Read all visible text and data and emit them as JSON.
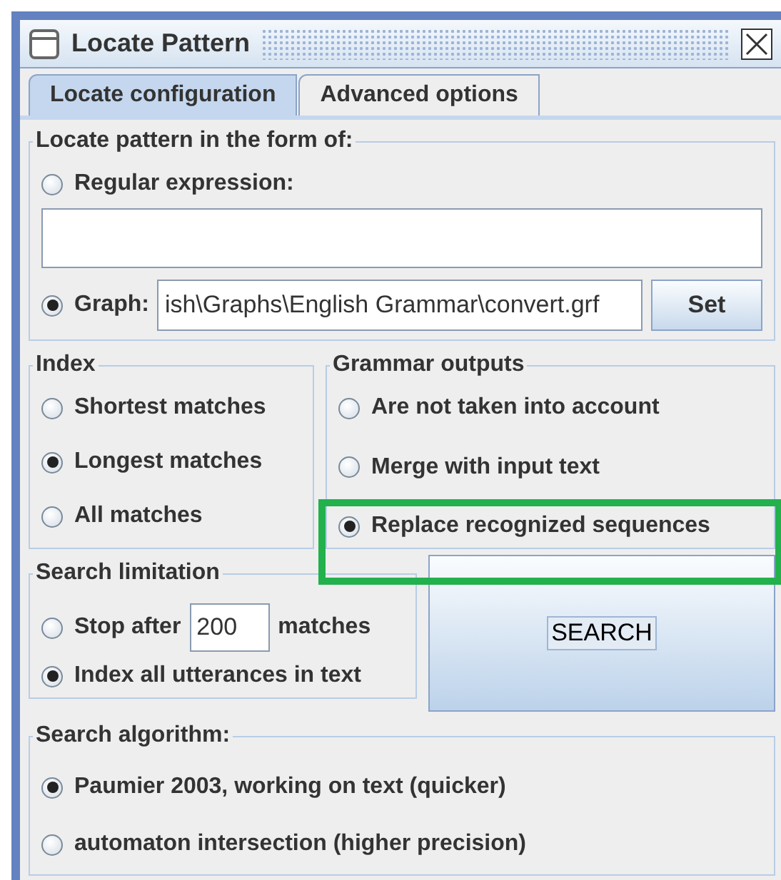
{
  "window": {
    "title": "Locate Pattern"
  },
  "tabs": [
    {
      "label": "Locate configuration",
      "selected": true
    },
    {
      "label": "Advanced options",
      "selected": false
    }
  ],
  "pattern_group": {
    "title": "Locate pattern in the form of:",
    "regex_option": {
      "label": "Regular expression:",
      "selected": false
    },
    "graph_option": {
      "label": "Graph:",
      "selected": true
    },
    "graph_field": {
      "value": "ish\\Graphs\\English Grammar\\convert.grf"
    },
    "set_button": "Set"
  },
  "index_group": {
    "title": "Index",
    "options": [
      {
        "label": "Shortest matches",
        "selected": false
      },
      {
        "label": "Longest matches",
        "selected": true
      },
      {
        "label": "All matches",
        "selected": false
      }
    ]
  },
  "grammar_group": {
    "title": "Grammar outputs",
    "options": [
      {
        "label": "Are not taken into account",
        "selected": false,
        "highlighted": false
      },
      {
        "label": "Merge with input text",
        "selected": false,
        "highlighted": false
      },
      {
        "label": "Replace recognized sequences",
        "selected": true,
        "highlighted": true
      }
    ]
  },
  "limit_group": {
    "title": "Search limitation",
    "stop_option": {
      "label": "Stop after",
      "selected": false
    },
    "stop_field": {
      "value": "200"
    },
    "stop_suffix": "matches",
    "all_option": {
      "label": "Index all utterances in text",
      "selected": true
    }
  },
  "search_button": "SEARCH",
  "algorithm_group": {
    "title": "Search algorithm:",
    "options": [
      {
        "label": "Paumier 2003, working on text (quicker)",
        "selected": true
      },
      {
        "label": "automaton intersection (higher precision)",
        "selected": false
      }
    ]
  }
}
